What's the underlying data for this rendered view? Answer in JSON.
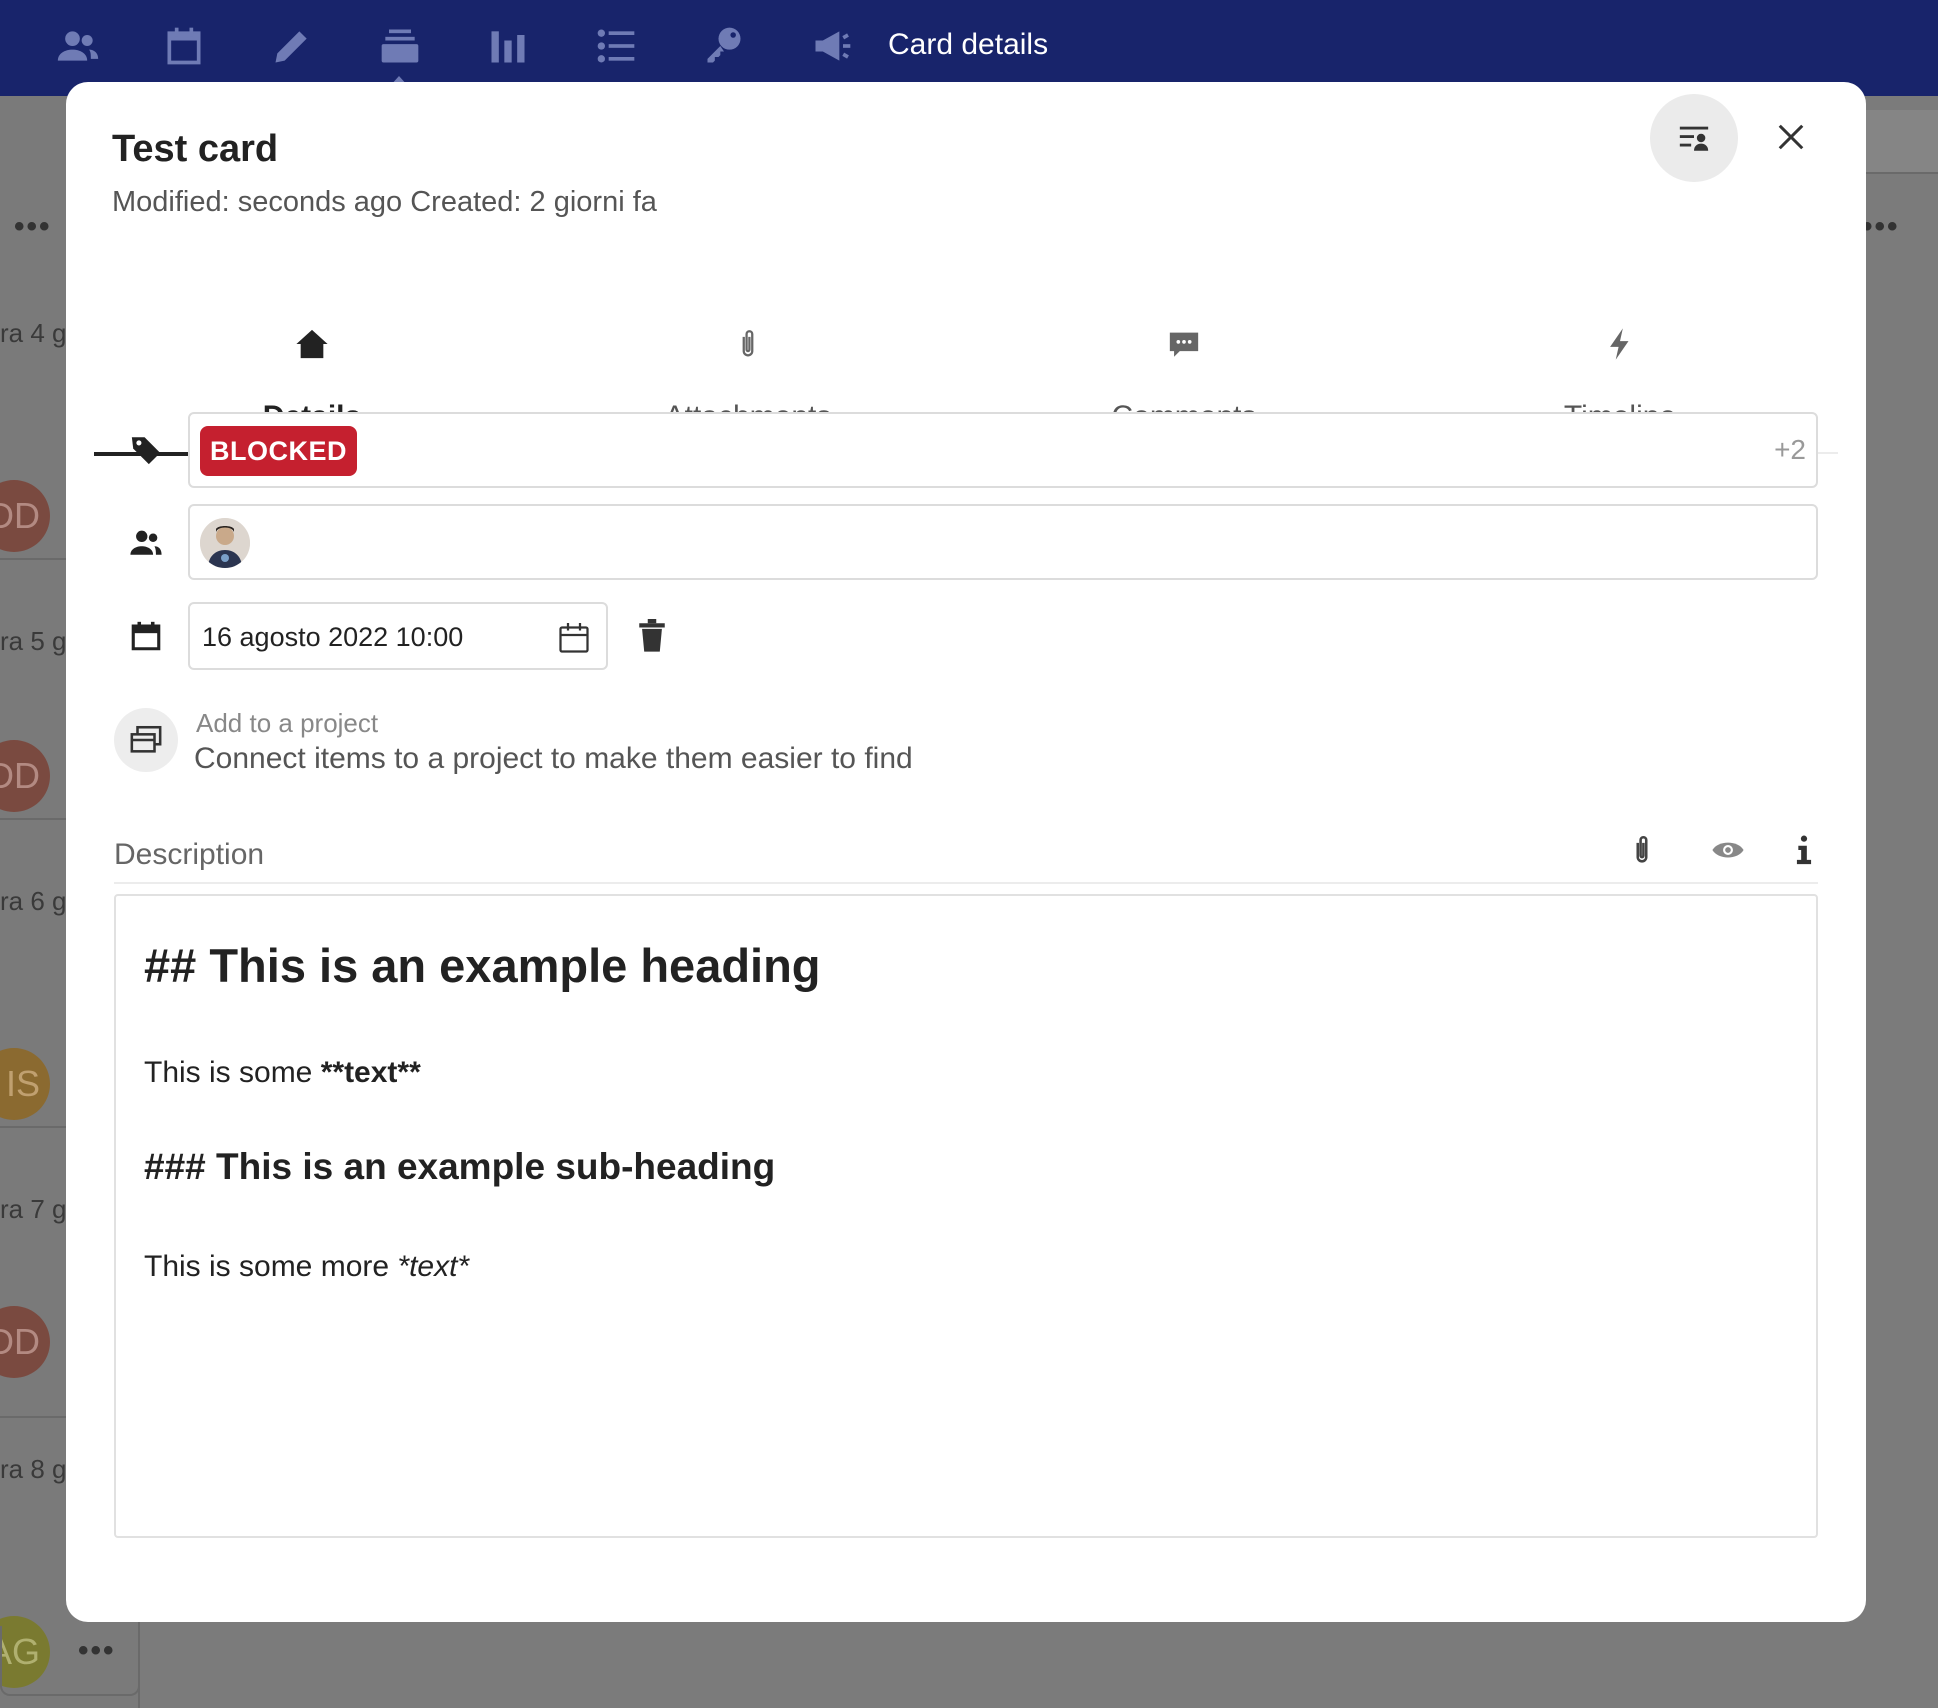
{
  "topbar": {
    "title": "Card details",
    "icons": [
      "contacts-icon",
      "calendar-icon",
      "pencil-icon",
      "deck-icon",
      "chart-icon",
      "list-icon",
      "key-icon",
      "megaphone-icon"
    ]
  },
  "background": {
    "rows": [
      "ra 4 g",
      "ra 5 g",
      "ra 6 g",
      "ra 7 g",
      "ra 8 g"
    ],
    "avatars": [
      "DD",
      "DD",
      "IS",
      "DD",
      "AG"
    ],
    "dots": "•••"
  },
  "card": {
    "title": "Test card",
    "subtitle": "Modified: seconds ago Created: 2 giorni fa"
  },
  "tabs": [
    {
      "label": "Details",
      "icon": "home-icon",
      "active": true
    },
    {
      "label": "Attachments",
      "icon": "paperclip-icon",
      "active": false
    },
    {
      "label": "Comments",
      "icon": "comment-icon",
      "active": false
    },
    {
      "label": "Timeline",
      "icon": "lightning-icon",
      "active": false
    }
  ],
  "details": {
    "tag": "BLOCKED",
    "tag_color": "#c5202f",
    "tag_more": "+2",
    "due_date": "16 agosto 2022 10:00",
    "project_title": "Add to a project",
    "project_sub": "Connect items to a project to make them easier to find"
  },
  "description": {
    "label": "Description",
    "h2": "## This is an example heading",
    "p1_plain": "This is some ",
    "p1_bold": "**text**",
    "h3": "### This is an example sub-heading",
    "p2_plain": "This is some more ",
    "p2_italic": "*text*"
  }
}
